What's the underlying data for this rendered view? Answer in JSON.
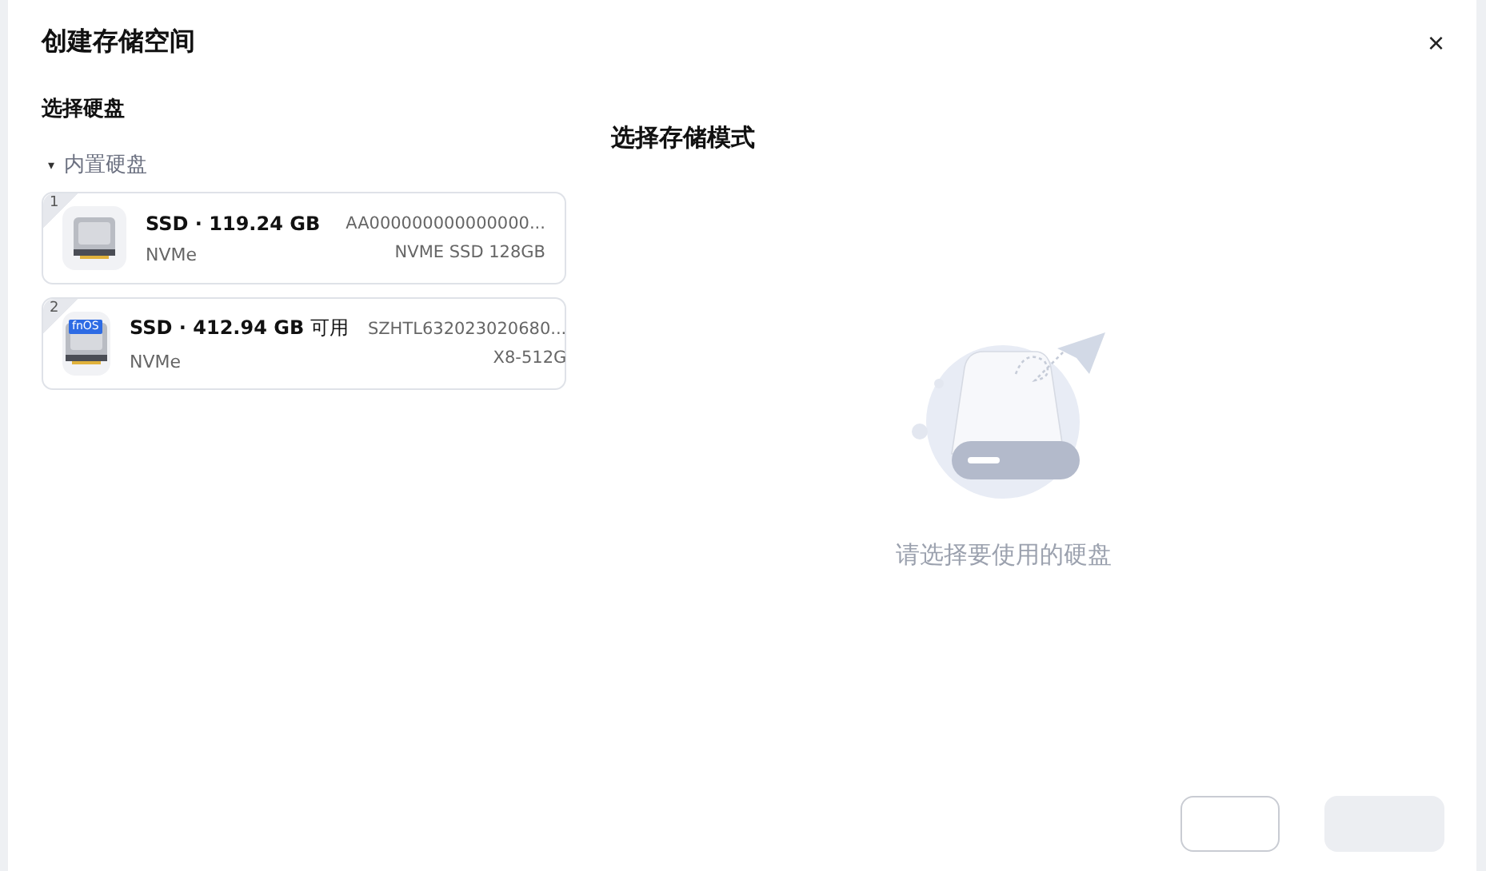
{
  "dialog": {
    "title": "创建存储空间",
    "close": "×"
  },
  "disk_panel": {
    "heading": "选择硬盘",
    "group": {
      "label": "内置硬盘",
      "expanded": true,
      "caret": "▾"
    },
    "disks": [
      {
        "index": "1",
        "name": "**SSD · 119.24 GB**",
        "type": "NVMe",
        "serial": "AA000000000000000...",
        "model": "NVME SSD 128GB",
        "selected": false
      },
      {
        "index": "2",
        "badge": "fnOS",
        "name": "**SSD · 412.94 GB** 可用",
        "type": "NVMe",
        "serial": "SZHTL632023020680...",
        "model": "X8-512G",
        "selected": false
      }
    ]
  },
  "mode_panel": {
    "heading": "选择存储模式",
    "empty_text": "请选择要使用的硬盘"
  },
  "buttons": [
    {
      "kind": "outline",
      "disabled": false
    },
    {
      "kind": "primary",
      "disabled": true
    }
  ]
}
